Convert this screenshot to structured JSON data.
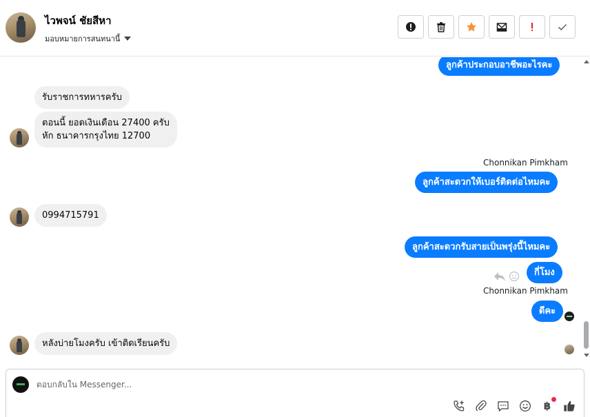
{
  "header": {
    "contact_name": "ไวพจน์ ชัยสีหา",
    "assign_label": "มอบหมายการสนทนานี้",
    "actions": [
      {
        "name": "report-spam-button",
        "icon": "exclamation-circle-icon"
      },
      {
        "name": "delete-button",
        "icon": "trash-icon"
      },
      {
        "name": "star-button",
        "icon": "star-icon"
      },
      {
        "name": "mark-unread-button",
        "icon": "envelope-icon"
      },
      {
        "name": "flag-button",
        "icon": "exclamation-icon"
      },
      {
        "name": "mark-done-button",
        "icon": "check-icon"
      }
    ]
  },
  "messages": {
    "m1": "ลูกค้าประกอบอาชีพอะไรคะ",
    "m2": "รับราชการทหารครับ",
    "m3_line1": "ตอนนี้ ยอดเงินเดือน 27400 ครับ",
    "m3_line2": "หัก ธนาคารกรุงไทย 12700",
    "sender_1": "Chonnikan Pimkham",
    "m4": "ลูกค้าสะดวกให้เบอร์ติดต่อไหมคะ",
    "m5": "0994715791",
    "m6": "ลูกค้าสะดวกรับสายเป็นพรุ่งนี้ไหมคะ",
    "m7": "กี่โมง",
    "sender_2": "Chonnikan Pimkham",
    "m8": "ดีคะ",
    "m9": "หลังบ่ายโมงครับ เข้าติดเรียนครับ"
  },
  "composer": {
    "placeholder": "ตอบกลับใน Messenger...",
    "tools": [
      "call-add-icon",
      "attachment-icon",
      "quick-reply-icon",
      "emoji-icon",
      "baht-payment-icon",
      "like-icon"
    ],
    "baht_symbol": "฿"
  },
  "colors": {
    "outgoing_bubble": "#0a7cff",
    "incoming_bubble": "#f0f0f0",
    "star": "#f7923a",
    "flag": "#e02020"
  }
}
